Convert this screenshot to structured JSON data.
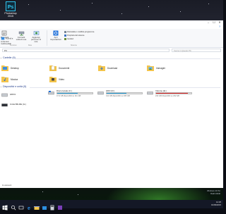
{
  "desktop": {
    "icon_label": "Photoshop\n2015",
    "sysinfo": [
      "Windows 10 Pro",
      "Build 10240"
    ]
  },
  "window": {
    "controls": [
      "–",
      "☐",
      "✕"
    ],
    "help": "?",
    "ribbon": {
      "tabs": [
        "File",
        "Computer",
        "Visualizza"
      ],
      "big_buttons": [
        {
          "label": "Proprietà",
          "icon": "properties-icon"
        },
        {
          "label": "Accedi a contenuti multimediali",
          "icon": "media-icon"
        },
        {
          "label": "Connetti unità di rete",
          "icon": "network-drive-icon"
        },
        {
          "label": "Aggiungi percorso di rete",
          "icon": "add-network-location-icon"
        },
        {
          "label": "Apri Impostazioni",
          "icon": "settings-icon"
        }
      ],
      "small_buttons": [
        {
          "label": "Disinstalla o modifica programma",
          "icon": "uninstall-icon"
        },
        {
          "label": "Proprietà del sistema",
          "icon": "system-properties-icon"
        },
        {
          "label": "Gestisci",
          "icon": "manage-icon"
        }
      ],
      "groups": [
        "Percorso",
        "Rete",
        "Sistema"
      ]
    },
    "address": {
      "path": "PC",
      "search_placeholder": "Cerca in Questo PC"
    },
    "folders_header": "Cartelle (6)",
    "folders": [
      {
        "label": "Desktop",
        "icon": "desktop-folder-icon"
      },
      {
        "label": "Documenti",
        "icon": "documents-folder-icon"
      },
      {
        "label": "Download",
        "icon": "downloads-folder-icon"
      },
      {
        "label": "Immagini",
        "icon": "pictures-folder-icon"
      },
      {
        "label": "Musica",
        "icon": "music-folder-icon"
      },
      {
        "label": "Video",
        "icon": "videos-folder-icon"
      }
    ],
    "drives_header": "Dispositivi e unità (5)",
    "drives": [
      {
        "name": "HDD1",
        "bar": false
      },
      {
        "name": "Disco locale (C:)",
        "bar": true,
        "used": 0.58,
        "free": "47,3 GB disponibili su 111 GB"
      },
      {
        "name": "HDD (D:)",
        "bar": true,
        "used": 0.55,
        "free": "411 GB disponibili su 465 GB"
      },
      {
        "name": "Volume (E:)",
        "bar": true,
        "used": 0.9,
        "free": "222 GB disponibili su 232 GB"
      },
      {
        "name": "Unità BD-RE (G:)",
        "bar": false
      }
    ],
    "status": "11 elementi"
  },
  "taskbar": {
    "items": [
      "start-icon",
      "search-icon",
      "task-view-icon",
      "edge-icon",
      "file-explorer-icon",
      "store-icon",
      "calculator-icon",
      "app-icon"
    ],
    "time": "12:25",
    "date": "01/09/2015"
  }
}
